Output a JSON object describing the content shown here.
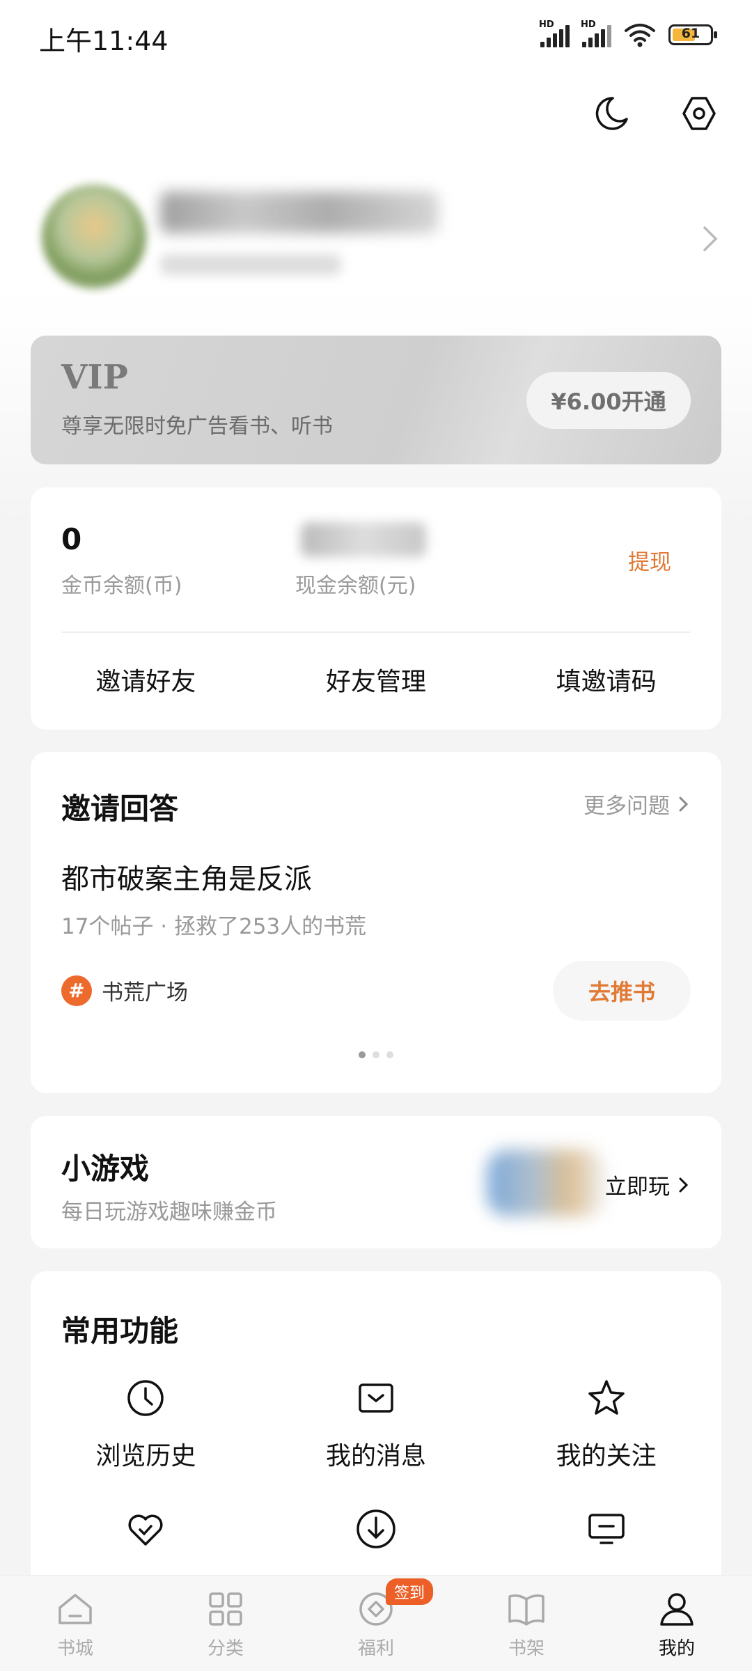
{
  "status_bar": {
    "time": "上午11:44",
    "signal1": "HD",
    "signal2": "HD",
    "battery": "61"
  },
  "header": {
    "night_icon": "moon-icon",
    "settings_icon": "settings-hex-icon"
  },
  "vip": {
    "title": "VIP",
    "desc": "尊享无限时免广告看书、听书",
    "button": "¥6.00开通"
  },
  "wallet": {
    "coins_value": "0",
    "coins_label": "金币余额(币)",
    "cash_label": "现金余额(元)",
    "withdraw": "提现",
    "actions": [
      "邀请好友",
      "好友管理",
      "填邀请码"
    ]
  },
  "invite": {
    "title": "邀请回答",
    "more": "更多问题",
    "question": "都市破案主角是反派",
    "meta": "17个帖子 · 拯救了253人的书荒",
    "tag_symbol": "#",
    "tag": "书荒广场",
    "button": "去推书",
    "page_count": 3,
    "active_page": 1
  },
  "games": {
    "title": "小游戏",
    "desc": "每日玩游戏趣味赚金币",
    "play": "立即玩"
  },
  "common": {
    "title": "常用功能",
    "items": [
      {
        "label": "浏览历史",
        "icon": "clock-icon"
      },
      {
        "label": "我的消息",
        "icon": "message-icon"
      },
      {
        "label": "我的关注",
        "icon": "star-icon"
      },
      {
        "label": "",
        "icon": "heart-check-icon"
      },
      {
        "label": "",
        "icon": "download-icon"
      },
      {
        "label": "",
        "icon": "monitor-icon"
      }
    ]
  },
  "tabbar": {
    "items": [
      {
        "label": "书城",
        "icon": "home-icon"
      },
      {
        "label": "分类",
        "icon": "grid-icon"
      },
      {
        "label": "福利",
        "icon": "coin-icon",
        "badge": "签到"
      },
      {
        "label": "书架",
        "icon": "book-icon"
      },
      {
        "label": "我的",
        "icon": "user-icon"
      }
    ],
    "active": 4
  },
  "colors": {
    "accent": "#e07b36",
    "badge": "#ec5f27",
    "bg": "#f4f4f4"
  }
}
